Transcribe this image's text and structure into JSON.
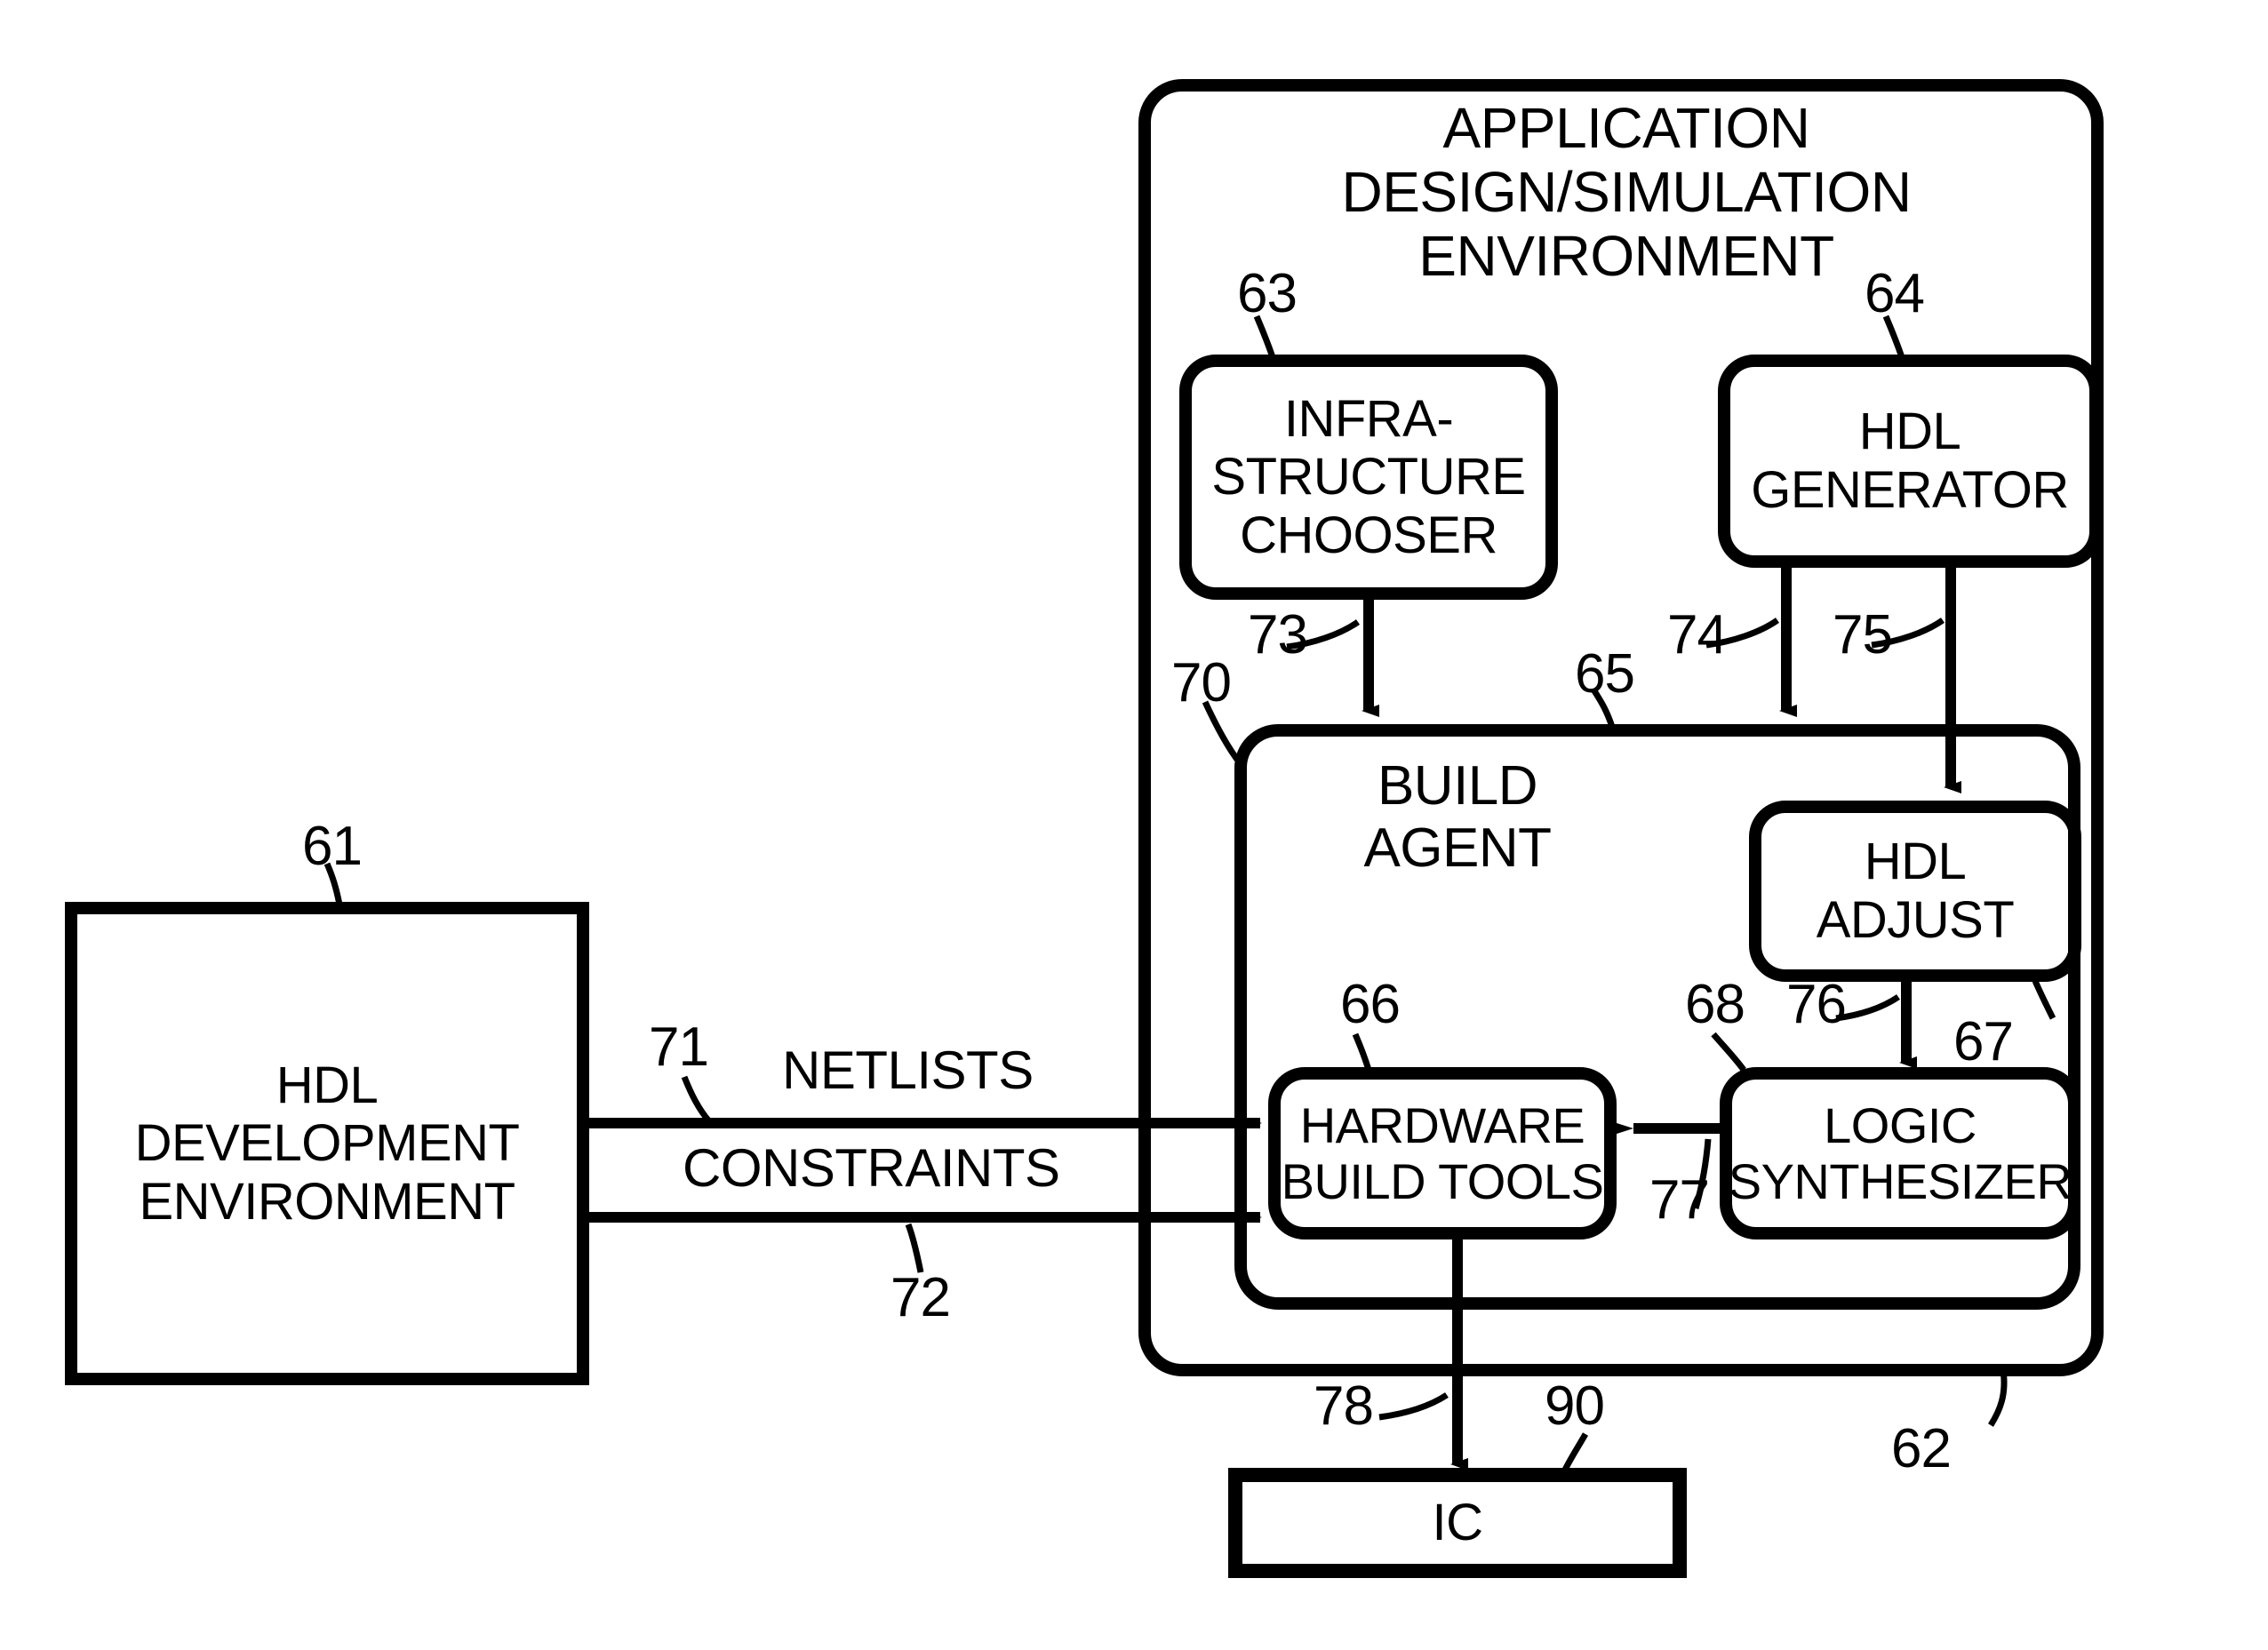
{
  "figure": {
    "type": "patent-block-diagram",
    "background_color": "#ffffff",
    "line_color": "#000000"
  },
  "containers": {
    "app_env": {
      "title": "APPLICATION\nDESIGN/SIMULATION\nENVIRONMENT",
      "ref": "62"
    },
    "build_agent": {
      "title": "BUILD\nAGENT",
      "ref": "65",
      "boundary_ref": "70"
    }
  },
  "blocks": [
    {
      "id": "hdl_dev_env",
      "label": "HDL\nDEVELOPMENT\nENVIRONMENT",
      "ref": "61",
      "shape": "rect"
    },
    {
      "id": "infra_chooser",
      "label": "INFRA-\nSTRUCTURE\nCHOOSER",
      "ref": "63",
      "shape": "rounded"
    },
    {
      "id": "hdl_generator",
      "label": "HDL\nGENERATOR",
      "ref": "64",
      "shape": "rounded"
    },
    {
      "id": "hdl_adjust",
      "label": "HDL\nADJUST",
      "ref": "67",
      "shape": "rounded"
    },
    {
      "id": "hw_build_tools",
      "label": "HARDWARE\nBUILD TOOLS",
      "ref": "66",
      "shape": "rounded"
    },
    {
      "id": "logic_synth",
      "label": "LOGIC\nSYNTHESIZER",
      "ref": "68",
      "shape": "rounded"
    },
    {
      "id": "ic",
      "label": "IC",
      "ref": "90",
      "shape": "rect-double"
    }
  ],
  "connections": [
    {
      "id": "netlists",
      "label": "NETLISTS",
      "ref": "71",
      "from": "hdl_dev_env",
      "to": "build_agent"
    },
    {
      "id": "constraints",
      "label": "CONSTRAINTS",
      "ref": "72",
      "from": "hdl_dev_env",
      "to": "build_agent"
    },
    {
      "id": "chooser_out",
      "label": "",
      "ref": "73",
      "from": "infra_chooser",
      "to": "build_agent"
    },
    {
      "id": "gen_out_a",
      "label": "",
      "ref": "74",
      "from": "hdl_generator",
      "to": "build_agent"
    },
    {
      "id": "gen_out_b",
      "label": "",
      "ref": "75",
      "from": "hdl_generator",
      "to": "hdl_adjust"
    },
    {
      "id": "adjust_out",
      "label": "",
      "ref": "76",
      "from": "hdl_adjust",
      "to": "logic_synth"
    },
    {
      "id": "synth_out",
      "label": "",
      "ref": "77",
      "from": "logic_synth",
      "to": "hw_build_tools"
    },
    {
      "id": "tools_out",
      "label": "",
      "ref": "78",
      "from": "hw_build_tools",
      "to": "ic"
    }
  ],
  "reference_numerals": {
    "n61": "61",
    "n62": "62",
    "n63": "63",
    "n64": "64",
    "n65": "65",
    "n66": "66",
    "n67": "67",
    "n68": "68",
    "n70": "70",
    "n71": "71",
    "n72": "72",
    "n73": "73",
    "n74": "74",
    "n75": "75",
    "n76": "76",
    "n77": "77",
    "n78": "78",
    "n90": "90"
  },
  "text_labels": {
    "app_env_title": "APPLICATION\nDESIGN/SIMULATION\nENVIRONMENT",
    "infra_chooser": "INFRA-\nSTRUCTURE\nCHOOSER",
    "hdl_generator": "HDL\nGENERATOR",
    "build_agent": "BUILD\nAGENT",
    "hdl_adjust": "HDL\nADJUST",
    "hardware_build_tools": "HARDWARE\nBUILD TOOLS",
    "logic_synthesizer": "LOGIC\nSYNTHESIZER",
    "hdl_development_environment": "HDL\nDEVELOPMENT\nENVIRONMENT",
    "netlists": "NETLISTS",
    "constraints": "CONSTRAINTS",
    "ic": "IC"
  }
}
